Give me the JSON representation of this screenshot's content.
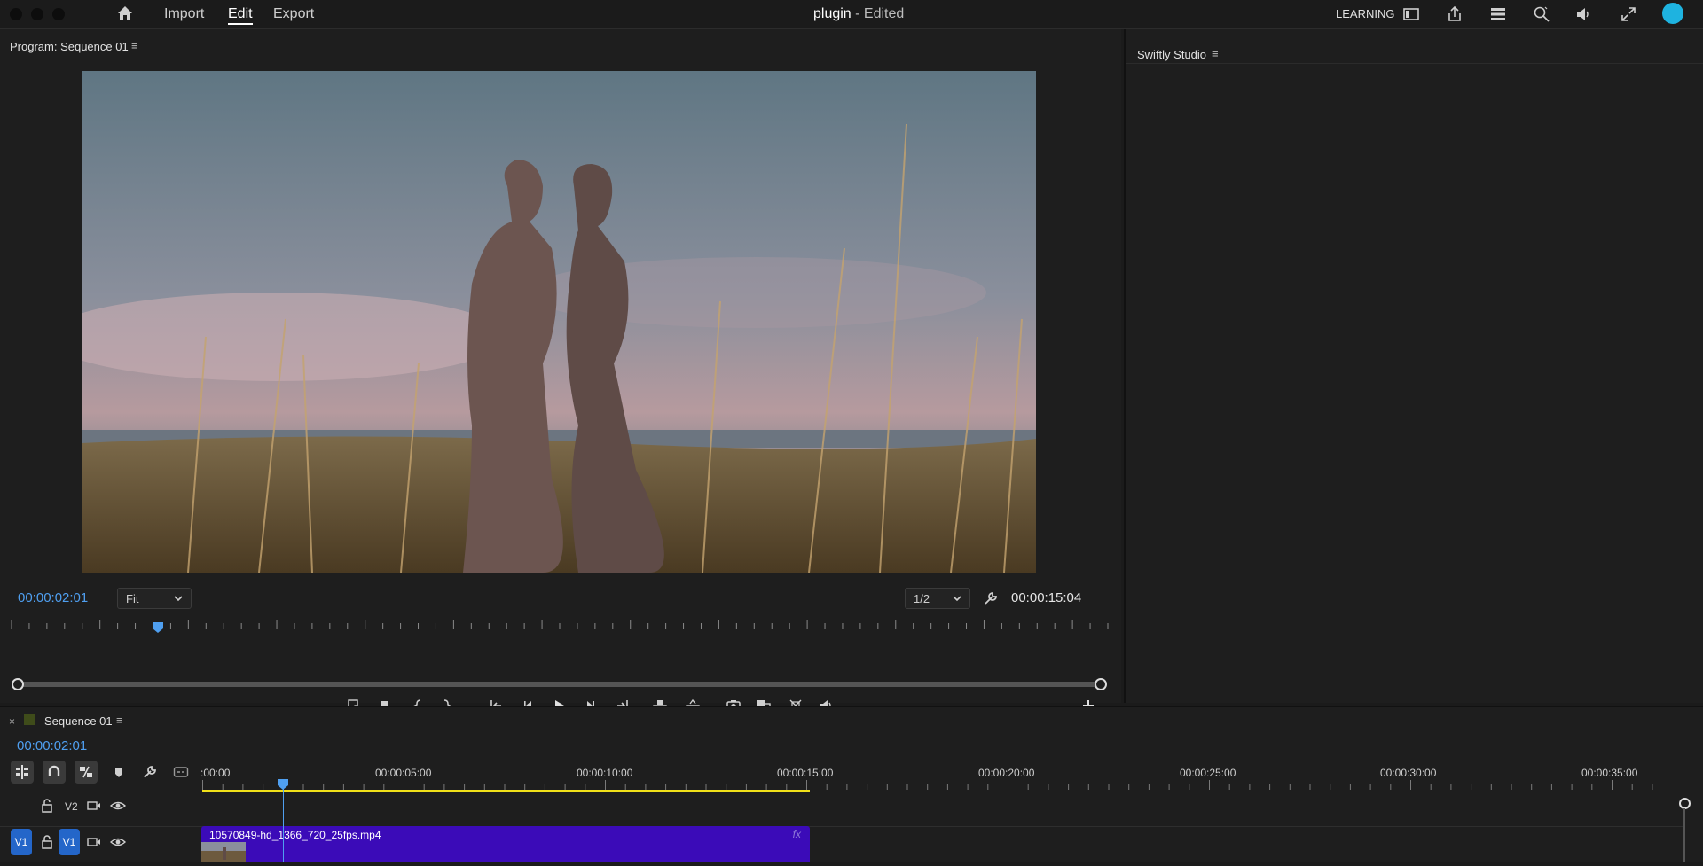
{
  "topbar": {
    "nav": [
      "Import",
      "Edit",
      "Export"
    ],
    "active_nav": "Edit",
    "project_name": "plugin",
    "project_status": "- Edited",
    "learning": "LEARNING",
    "icons": [
      "home-icon",
      "panel-layout-icon",
      "share-icon",
      "workspaces-icon",
      "zoom-icon",
      "volume-icon",
      "fullscreen-icon",
      "account-avatar-icon"
    ],
    "avatar_color": "#1eb3e0"
  },
  "program_monitor": {
    "title": "Program: Sequence 01",
    "current_time": "00:00:02:01",
    "zoom": "Fit",
    "resolution": "1/2",
    "duration": "00:00:15:04",
    "playhead_fraction": 0.134,
    "controls": [
      "marker-find-icon",
      "add-marker-icon",
      "mark-in-icon",
      "mark-out-icon",
      "go-to-in-icon",
      "step-back-icon",
      "play-icon",
      "step-forward-icon",
      "go-to-out-icon",
      "lift-icon",
      "extract-icon",
      "export-frame-icon",
      "comparison-view-icon",
      "trim-icon",
      "volume-icon",
      "add-button-icon"
    ]
  },
  "side_panel": {
    "title": "Swiftly Studio"
  },
  "timeline": {
    "title": "Sequence 01",
    "current_time": "00:00:02:01",
    "ruler_labels": [
      ":00:00",
      "00:00:05:00",
      "00:00:10:00",
      "00:00:15:00",
      "00:00:20:00",
      "00:00:25:00",
      "00:00:30:00",
      "00:00:35:00"
    ],
    "playhead_fraction": 0.055,
    "tracks": [
      {
        "name": "V2"
      },
      {
        "name": "V1",
        "source": "V1"
      }
    ],
    "clip": {
      "name": "10570849-hd_1366_720_25fps.mp4",
      "fx": "fx",
      "color": "#3b0bb8"
    }
  },
  "colors": {
    "accent": "#4f9ff0",
    "work_area": "#f0e019"
  }
}
